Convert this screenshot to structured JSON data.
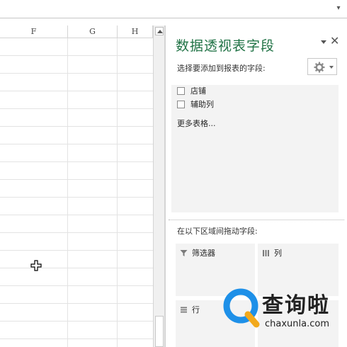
{
  "sheet": {
    "columns": [
      "F",
      "G",
      "H"
    ]
  },
  "pivot_pane": {
    "title": "数据透视表字段",
    "choose_fields_label": "选择要添加到报表的字段:",
    "fields": [
      {
        "label": "店铺",
        "checked": false
      },
      {
        "label": "辅助列",
        "checked": false
      }
    ],
    "more_tables": "更多表格...",
    "drag_label": "在以下区域间拖动字段:",
    "areas": {
      "filter": "筛选器",
      "columns": "列",
      "rows": "行"
    },
    "accent_color": "#217346"
  },
  "watermark": {
    "name": "查询啦",
    "url": "chaxunla.com",
    "color": "#1e90e8"
  },
  "icons": [
    "dropdown-arrow-icon",
    "move-cursor-icon",
    "scroll-up-icon",
    "pane-options-icon",
    "close-icon",
    "gear-icon",
    "filter-icon",
    "columns-icon",
    "rows-icon",
    "search-logo-icon"
  ]
}
